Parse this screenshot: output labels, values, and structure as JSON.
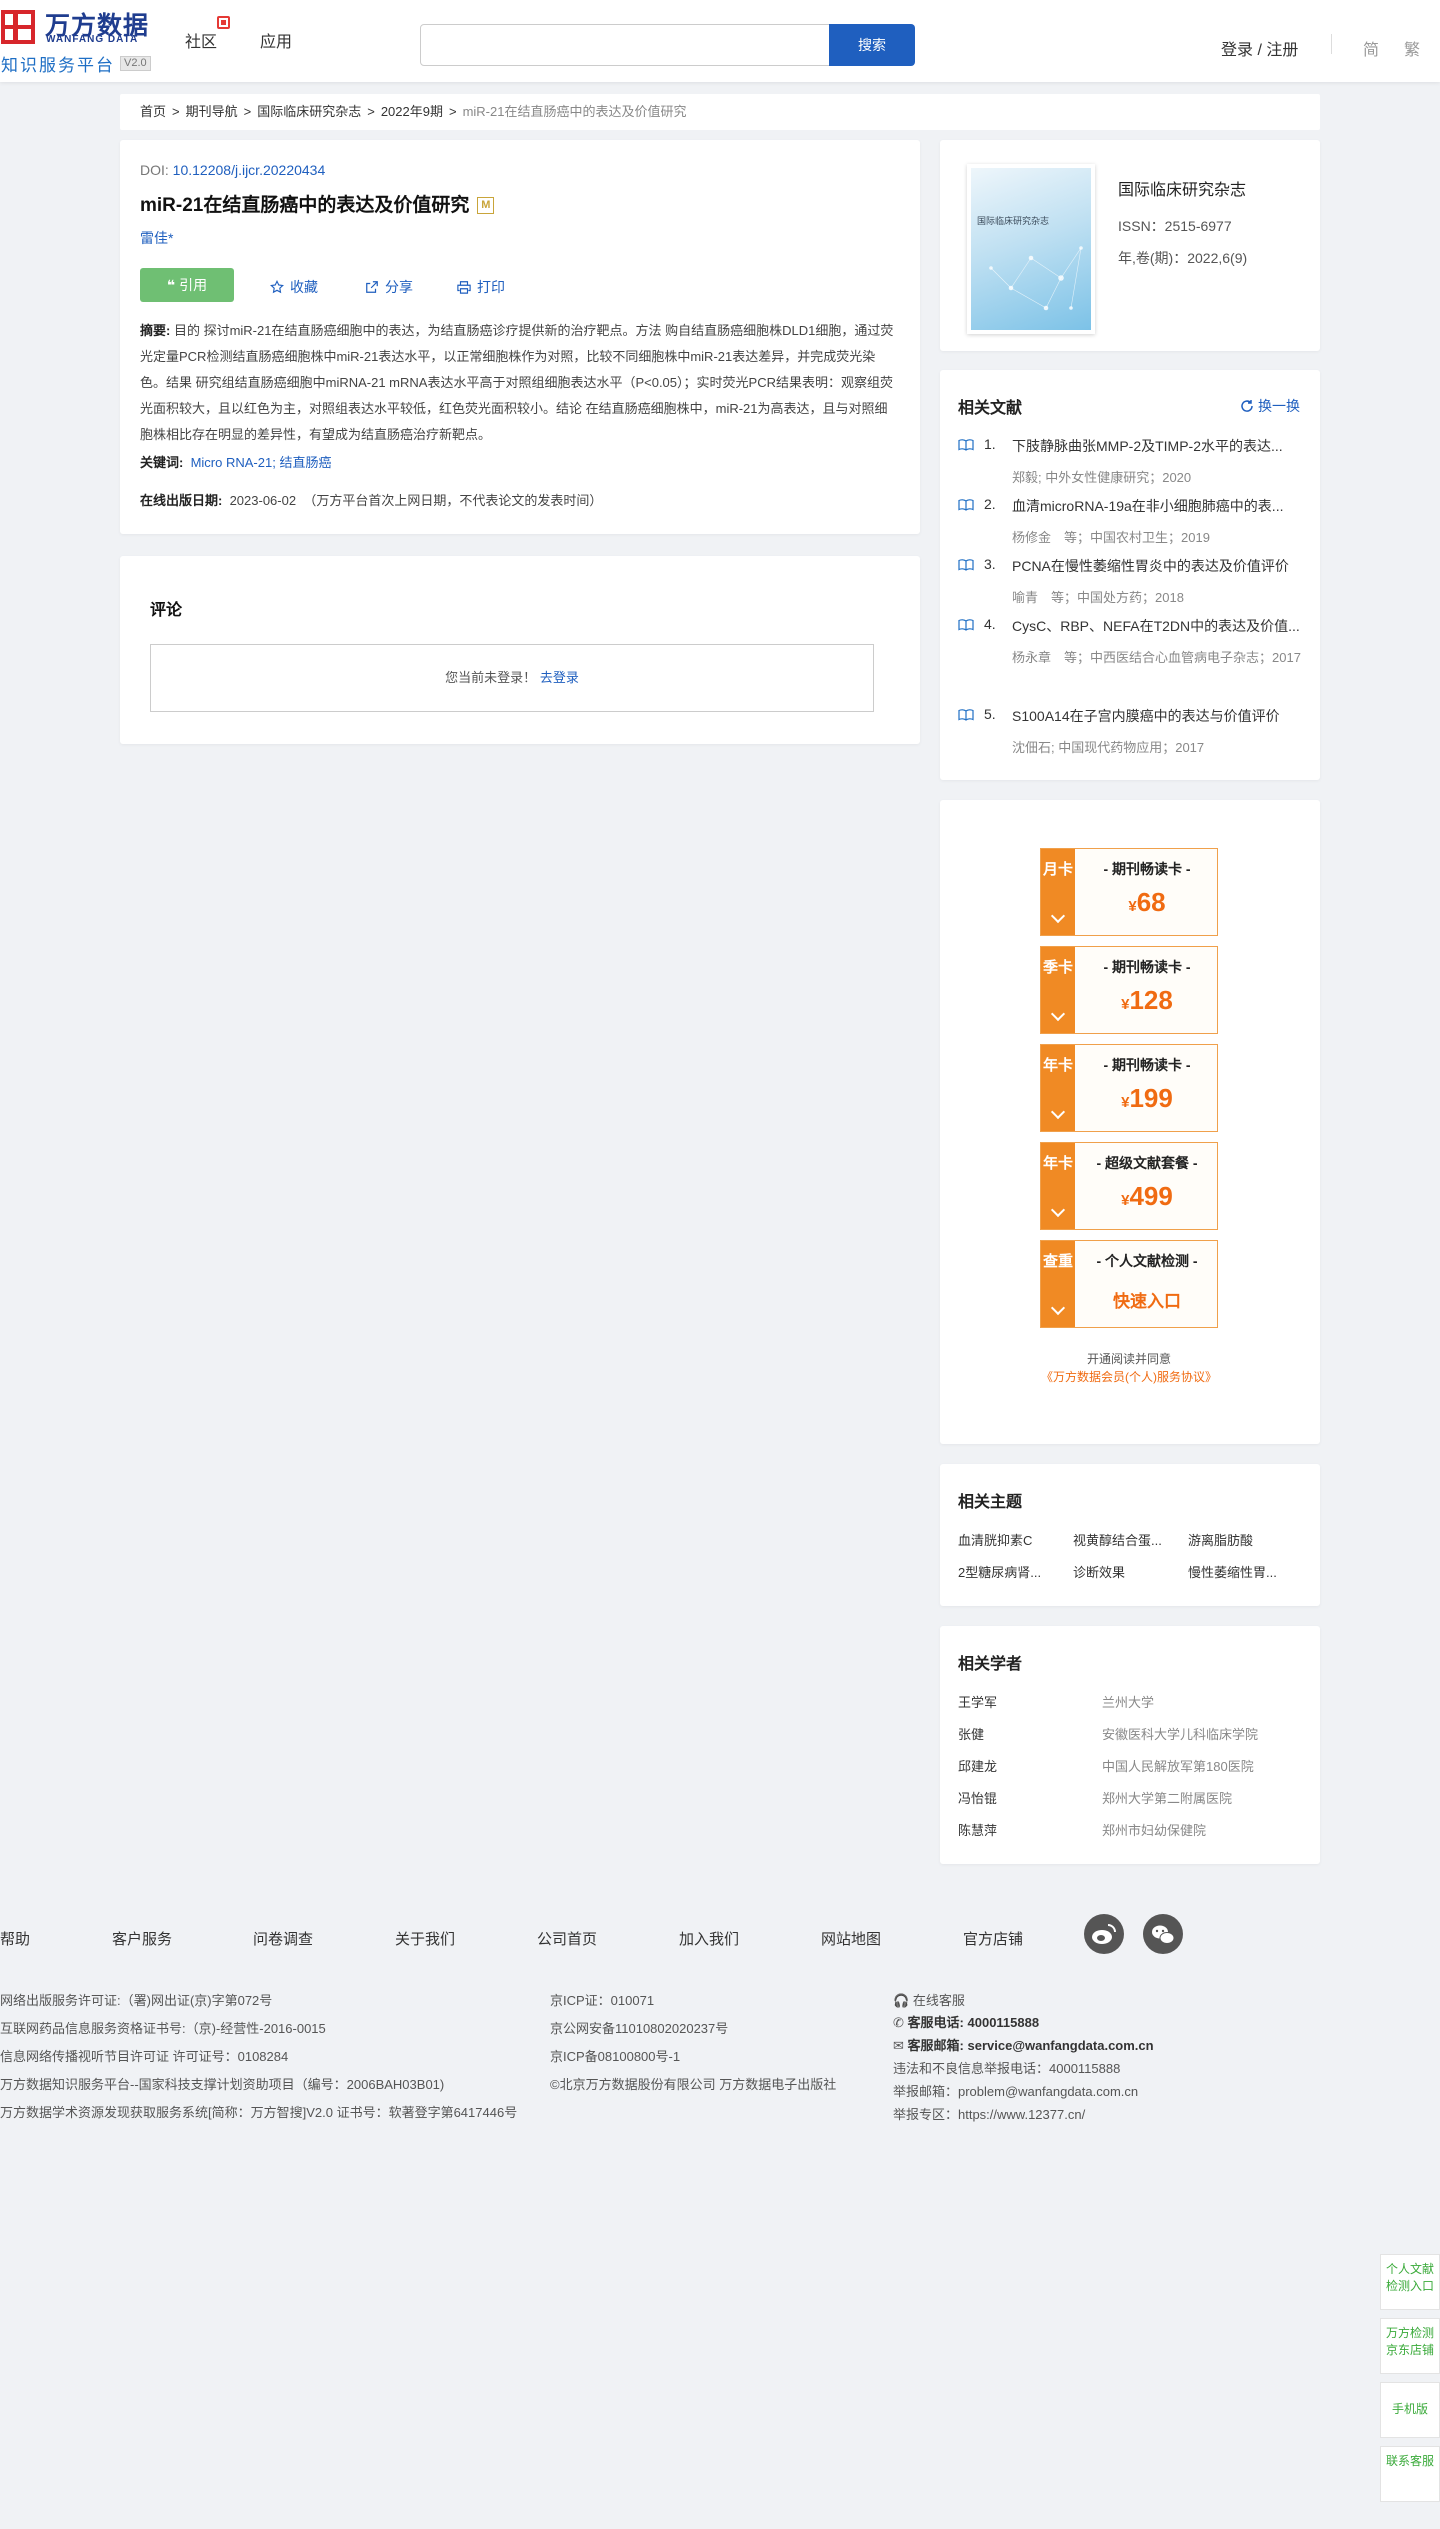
{
  "header": {
    "logo_cn": "万方数据",
    "logo_en": "WANFANG DATA",
    "logo_sub": "知识服务平台",
    "logo_ver": "V2.0",
    "nav": [
      "社区",
      "应用"
    ],
    "search_placeholder": "",
    "search_button": "搜索",
    "login": "登录 / 注册",
    "lang_simplified": "简",
    "lang_traditional": "繁"
  },
  "breadcrumb": [
    "首页",
    "期刊导航",
    "国际临床研究杂志",
    "2022年9期",
    "miR-21在结直肠癌中的表达及价值研究"
  ],
  "article": {
    "doi_label": "DOI:",
    "doi": "10.12208/j.ijcr.20220434",
    "title": "miR-21在结直肠癌中的表达及价值研究",
    "badge": "M",
    "author": "雷佳*",
    "actions": {
      "cite": "引用",
      "favorite": "收藏",
      "share": "分享",
      "print": "打印"
    },
    "abstract_label": "摘要:",
    "abstract": "目的 探讨miR-21在结直肠癌细胞中的表达，为结直肠癌诊疗提供新的治疗靶点。方法 购自结直肠癌细胞株DLD1细胞，通过荧光定量PCR检测结直肠癌细胞株中miR-21表达水平，以正常细胞株作为对照，比较不同细胞株中miR-21表达差异，并完成荧光染色。结果 研究组结直肠癌细胞中miRNA-21 mRNA表达水平高于对照组细胞表达水平（P<0.05）；实时荧光PCR结果表明：观察组荧光面积较大，且以红色为主，对照组表达水平较低，红色荧光面积较小。结论 在结直肠癌细胞株中，miR-21为高表达，且与对照细胞株相比存在明显的差异性，有望成为结直肠癌治疗新靶点。",
    "keywords_label": "关键词:",
    "keywords": [
      "Micro RNA-21",
      "结直肠癌"
    ],
    "keyword_sep": ";",
    "pubdate_label": "在线出版日期:",
    "pubdate": "2023-06-02",
    "pubdate_note": "（万方平台首次上网日期，不代表论文的发表时间）"
  },
  "comments": {
    "title": "评论",
    "not_logged_in": "您当前未登录！",
    "login_link": "去登录"
  },
  "journal": {
    "cover_text": "国际临床研究杂志",
    "name": "国际临床研究杂志",
    "issn": "ISSN：2515-6977",
    "volume": "年,卷(期)：2022,6(9)"
  },
  "related_docs": {
    "title": "相关文献",
    "refresh": "换一换",
    "items": [
      {
        "num": "1.",
        "title": "下肢静脉曲张MMP-2及TIMP-2水平的表达...",
        "meta": "郑毅; 中外女性健康研究；2020"
      },
      {
        "num": "2.",
        "title": "血清microRNA-19a在非小细胞肺癌中的表...",
        "meta": "杨修金　等；中国农村卫生；2019"
      },
      {
        "num": "3.",
        "title": "PCNA在慢性萎缩性胃炎中的表达及价值评价",
        "meta": "喻青　等；中国处方药；2018"
      },
      {
        "num": "4.",
        "title": "CysC、RBP、NEFA在T2DN中的表达及价值...",
        "meta": "杨永章　等；中西医结合心血管病电子杂志；2017"
      },
      {
        "num": "5.",
        "title": "S100A14在子宫内膜癌中的表达与价值评价",
        "meta": "沈佃石; 中国现代药物应用；2017"
      }
    ]
  },
  "cards": {
    "items": [
      {
        "tag": "月卡",
        "name": "- 期刊畅读卡 -",
        "currency": "¥",
        "price": "68"
      },
      {
        "tag": "季卡",
        "name": "- 期刊畅读卡 -",
        "currency": "¥",
        "price": "128"
      },
      {
        "tag": "年卡",
        "name": "- 期刊畅读卡 -",
        "currency": "¥",
        "price": "199"
      },
      {
        "tag": "年卡",
        "name": "- 超级文献套餐 -",
        "currency": "¥",
        "price": "499"
      },
      {
        "tag": "查重",
        "name": "- 个人文献检测 -",
        "currency": "",
        "price": "快速入口"
      }
    ],
    "note": "开通阅读并同意",
    "agreement": "《万方数据会员(个人)服务协议》"
  },
  "topics": {
    "title": "相关主题",
    "items": [
      "血清胱抑素C",
      "视黄醇结合蛋...",
      "游离脂肪酸",
      "2型糖尿病肾...",
      "诊断效果",
      "慢性萎缩性胃..."
    ]
  },
  "scholars": {
    "title": "相关学者",
    "items": [
      {
        "name": "王学军",
        "org": "兰州大学"
      },
      {
        "name": "张健",
        "org": "安徽医科大学儿科临床学院"
      },
      {
        "name": "邱建龙",
        "org": "中国人民解放军第180医院"
      },
      {
        "name": "冯怡锟",
        "org": "郑州大学第二附属医院"
      },
      {
        "name": "陈慧萍",
        "org": "郑州市妇幼保健院"
      }
    ]
  },
  "footer": {
    "links": [
      "帮助",
      "客户服务",
      "问卷调查",
      "关于我们",
      "公司首页",
      "加入我们",
      "网站地图",
      "官方店铺"
    ],
    "col1": [
      "网络出版服务许可证:（署)网出证(京)字第072号",
      "互联网药品信息服务资格证书号:（京)-经营性-2016-0015",
      "信息网络传播视听节目许可证 许可证号：0108284",
      "万方数据知识服务平台--国家科技支撑计划资助项目（编号：2006BAH03B01)",
      "万方数据学术资源发现获取服务系统[简称：万方智搜]V2.0 证书号：软著登字第6417446号"
    ],
    "col2": [
      "京ICP证：010071",
      "京公网安备11010802020237号",
      "京ICP备08100800号-1",
      "©北京万方数据股份有限公司 万方数据电子出版社"
    ],
    "online_service": "在线客服",
    "phone_label": "客服电话:",
    "phone": "4000115888",
    "email_label": "客服邮箱:",
    "email": "service@wanfangdata.com.cn",
    "report_line": "违法和不良信息举报电话：4000115888",
    "report_email": "举报邮箱：problem@wanfangdata.com.cn",
    "report_zone": "举报专区：https://www.12377.cn/"
  },
  "side_float": [
    "个人文献检测入口",
    "万方检测京东店铺",
    "手机版",
    "联系客服"
  ],
  "colors": {
    "brand_blue": "#1f5fbf",
    "cite_green": "#6fbf73",
    "orange": "#f08a24"
  }
}
